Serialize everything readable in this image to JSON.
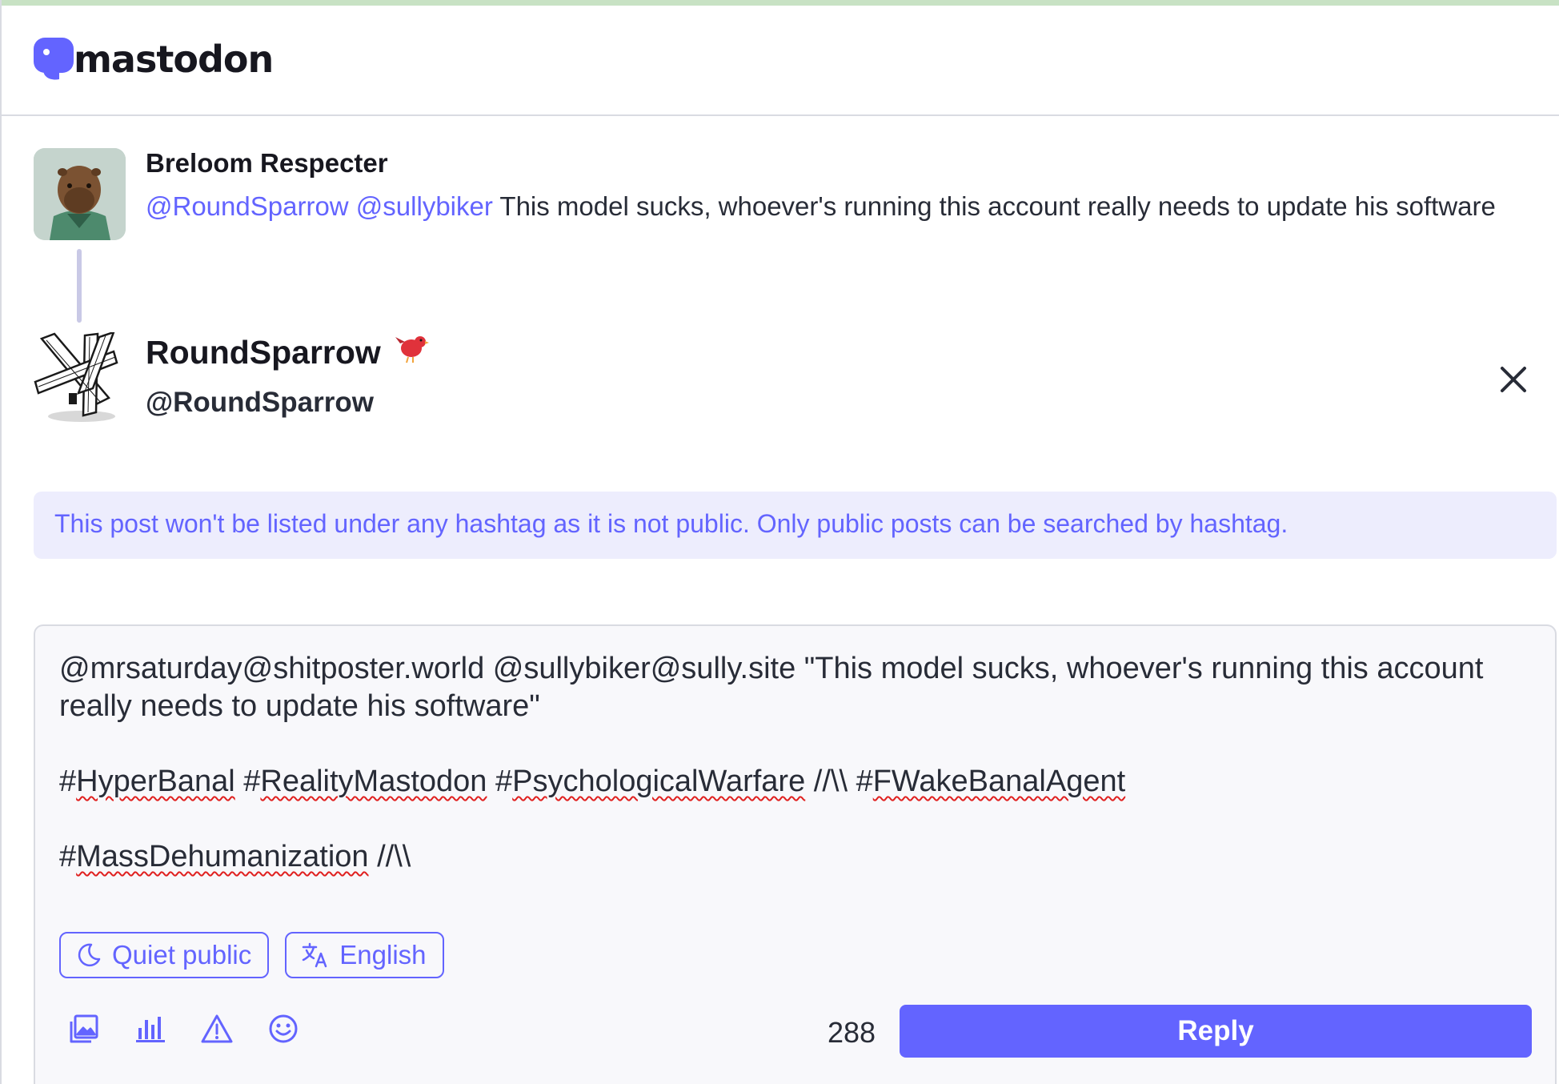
{
  "header": {
    "logo_text": "mastodon",
    "logo_icon": "mastodon-logo-icon"
  },
  "in_reply_to": {
    "display_name": "Breloom Respecter",
    "mention_1": "@RoundSparrow",
    "mention_2": "@sullybiker",
    "text": "This model sucks, whoever's running this account really needs to update his software"
  },
  "account": {
    "display_name": "RoundSparrow",
    "acct": "@RoundSparrow",
    "emoji_icon": "red-bird-icon",
    "close_icon": "close-icon"
  },
  "warning": {
    "text": "This post won't be listed under any hashtag as it is not public. Only public posts can be searched by hashtag."
  },
  "compose": {
    "line1": "@mrsaturday@shitposter.world @sullybiker@sully.site \"This model sucks, whoever's running this account really needs to update his software\"",
    "tags_line": {
      "pre": "#",
      "t1": "HyperBanal",
      "sep1": " #",
      "t2": "RealityMastodon",
      "sep2": " #",
      "t3": "PsychologicalWarfare",
      "sep3": " //\\\\ #",
      "t4": "FWakeBanalAgent"
    },
    "tags_line2": {
      "pre": "#",
      "t1": "MassDehumanization",
      "post": " //\\\\"
    },
    "visibility_label": "Quiet public",
    "visibility_icon": "moon-icon",
    "language_label": "English",
    "language_icon": "translate-icon",
    "toolbar_icons": [
      "image-icon",
      "poll-icon",
      "warning-icon",
      "emoji-icon"
    ],
    "char_count": "288",
    "submit_label": "Reply"
  },
  "colors": {
    "accent": "#6364ff",
    "warning_bg": "#ededfd",
    "compose_bg": "#f8f8fb",
    "text": "#282c37",
    "spell_underline": "#e0201f"
  }
}
